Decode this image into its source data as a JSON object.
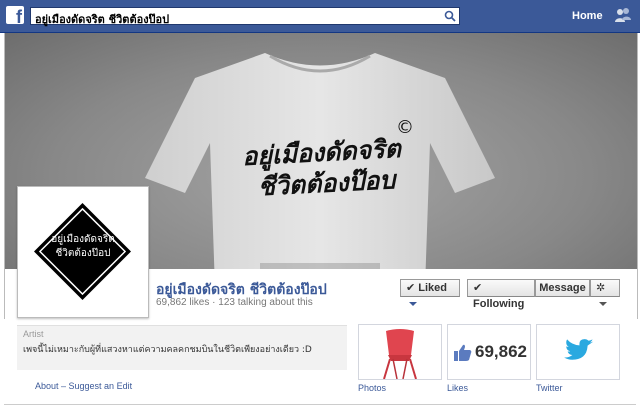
{
  "topbar": {
    "search_value": "อยู่เมืองดัดจริต ชีวิตต้องป๊อป",
    "nav_home": "Home"
  },
  "cover": {
    "shirt_line1": "อยู่เมืองดัดจริต",
    "shirt_line2": "ชีวิตต้องป๊อบ",
    "copyright_mark": "©"
  },
  "profile": {
    "picture_line1": "อยู่เมืองดัดจริต",
    "picture_line2": "ชีวิตต้องป๊อป"
  },
  "page": {
    "name": "อยู่เมืองดัดจริต ชีวิตต้องป๊อป",
    "stats": "69,862 likes · 123 talking about this"
  },
  "actions": {
    "liked": "Liked",
    "following": "Following",
    "message": "Message",
    "gear": "✲"
  },
  "about": {
    "category": "Artist",
    "description": "เพจนี้ไม่เหมาะกับผู้ที่แสวงหาแต่ความคลคกชมบินในชีวิตเพียงอย่างเดียว :D",
    "links": "About – Suggest an Edit"
  },
  "tiles": {
    "photos_label": "Photos",
    "likes_label": "Likes",
    "likes_count": "69,862",
    "twitter_label": "Twitter"
  },
  "colors": {
    "brand": "#3b5998",
    "twitter": "#2aa9e0",
    "chair": "#e0454f"
  },
  "icons": [
    "facebook-logo",
    "search-icon",
    "friends-icon",
    "thumbs-up-icon",
    "twitter-bird-icon",
    "gear-icon"
  ]
}
